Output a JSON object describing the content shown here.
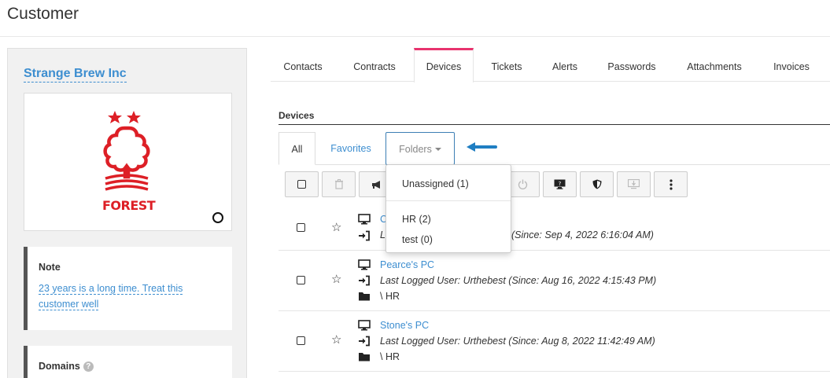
{
  "page": {
    "title": "Customer"
  },
  "customer": {
    "name": "Strange Brew Inc",
    "logo_text": "FOREST",
    "note": {
      "heading": "Note",
      "text": "23 years is a long time. Treat this customer well"
    },
    "domains": {
      "heading": "Domains"
    }
  },
  "tabs": [
    {
      "label": "Contacts"
    },
    {
      "label": "Contracts"
    },
    {
      "label": "Devices",
      "active": true
    },
    {
      "label": "Tickets"
    },
    {
      "label": "Alerts"
    },
    {
      "label": "Passwords"
    },
    {
      "label": "Attachments"
    },
    {
      "label": "Invoices"
    }
  ],
  "devices": {
    "section_title": "Devices",
    "subtabs": {
      "all": "All",
      "favorites": "Favorites",
      "folders": "Folders"
    },
    "folders_dropdown": [
      {
        "label": "Unassigned (1)"
      },
      {
        "label": "HR (2)"
      },
      {
        "label": "test (0)"
      }
    ],
    "toolbar": [
      {
        "icon": "checkbox-icon"
      },
      {
        "icon": "trash-icon"
      },
      {
        "icon": "megaphone-icon"
      },
      {
        "icon": "power-icon"
      },
      {
        "icon": "remote-desktop-icon"
      },
      {
        "icon": "shield-icon"
      },
      {
        "icon": "download-to-screen-icon"
      },
      {
        "icon": "more-vertical-icon"
      }
    ],
    "rows": [
      {
        "name": "C",
        "login_text": "(Since: Sep 4, 2022 6:16:04 AM)",
        "folder": ""
      },
      {
        "name": "Pearce's PC",
        "login_text": "Last Logged User: Urthebest (Since: Aug 16, 2022 4:15:43 PM)",
        "folder": "\\ HR"
      },
      {
        "name": "Stone's PC",
        "login_text": "Last Logged User: Urthebest (Since: Aug 8, 2022 11:42:49 AM)",
        "folder": "\\ HR"
      }
    ],
    "row0_login_prefix": "L"
  },
  "colors": {
    "link": "#3d8ed0",
    "active_tab": "#e8336e",
    "logo_red": "#dd1f26",
    "arrow": "#1f7ec2"
  }
}
